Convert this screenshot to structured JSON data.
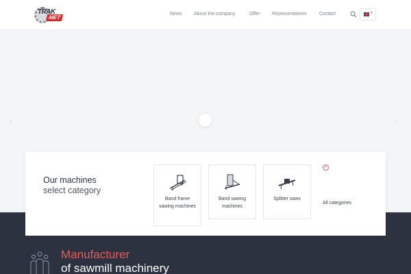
{
  "header": {
    "logo": {
      "word1": "TRAK",
      "word2": "MET"
    },
    "nav": [
      "News",
      "About the company",
      "Offer",
      "Representatives",
      "Contact"
    ],
    "language": "EN",
    "accent_color": "#e05757"
  },
  "slider": {
    "prev": "‹",
    "next": "›"
  },
  "machines": {
    "title": "Our machines",
    "subtitle": "select category",
    "items": [
      {
        "label": "Band frame sawing machines",
        "icon": "band-frame-saw-icon"
      },
      {
        "label": "Band sawing machines",
        "icon": "band-saw-icon"
      },
      {
        "label": "Splitter saws",
        "icon": "splitter-saw-icon"
      }
    ],
    "all_label": "All categories",
    "all_icon": "plus-circle-icon"
  },
  "manufacturer": {
    "line1": "Manufacturer",
    "line2": "of sawmill machinery",
    "icon": "people-icon"
  },
  "colors": {
    "dark_bg": "#2d3240",
    "accent": "#e85a5a"
  }
}
